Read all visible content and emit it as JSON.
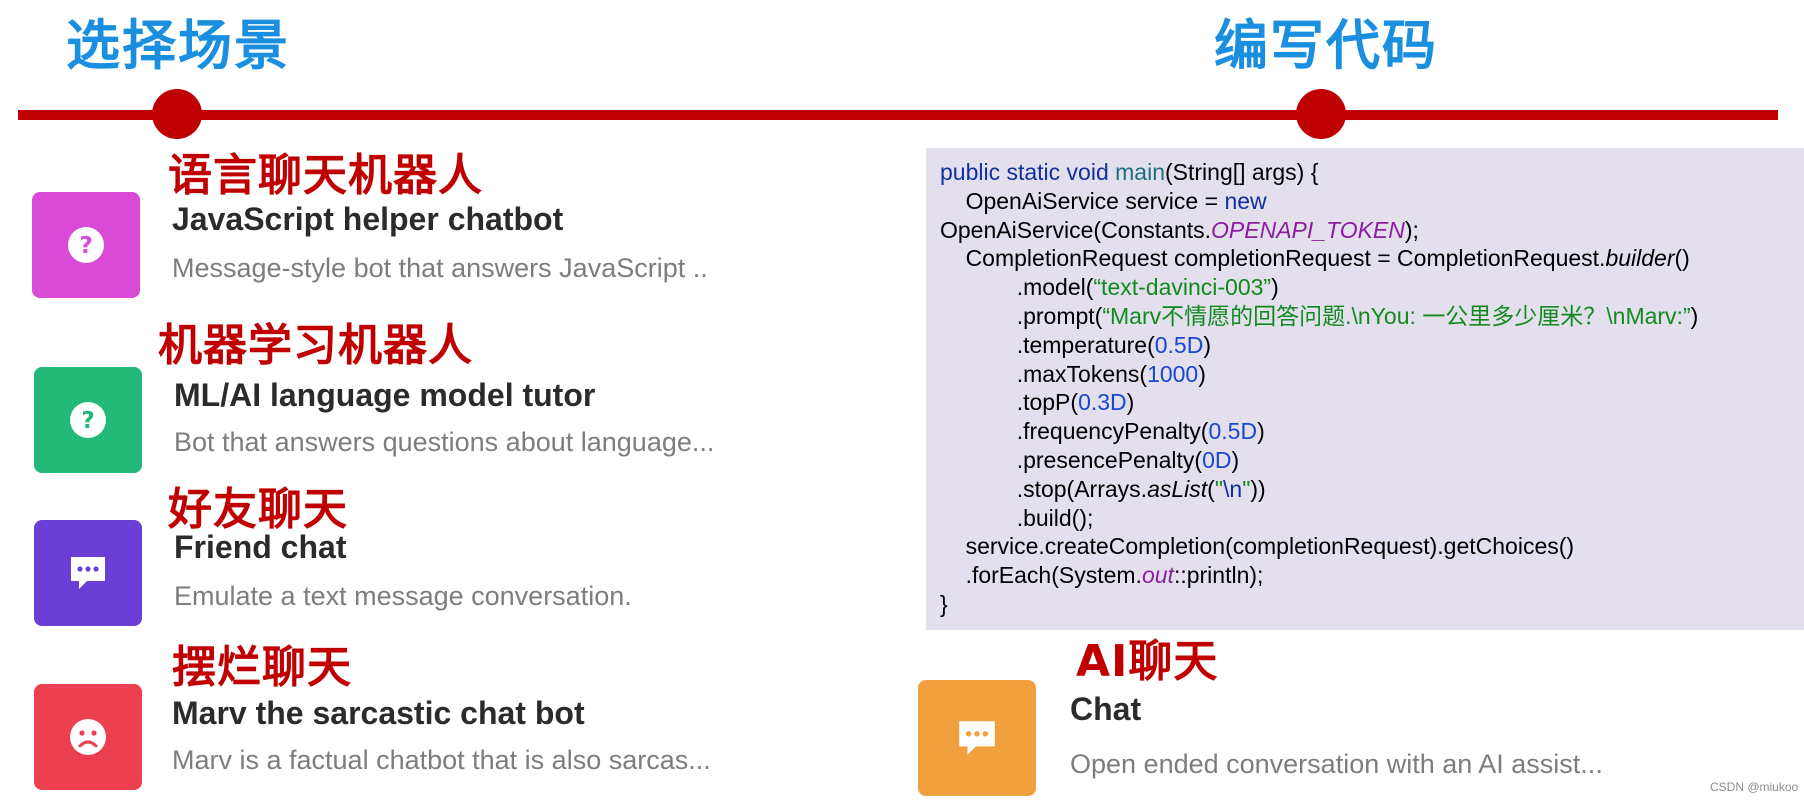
{
  "steps": [
    {
      "title": "选择场景"
    },
    {
      "title": "编写代码"
    }
  ],
  "cards": [
    {
      "tag": "语言聊天机器人",
      "title": "JavaScript helper chatbot",
      "description": "Message-style bot that answers JavaScript ..",
      "icon": "question-circle-icon",
      "color": "#d94ad6"
    },
    {
      "tag": "机器学习机器人",
      "title": "ML/AI language model tutor",
      "description": "Bot that answers questions about language...",
      "icon": "question-circle-icon",
      "color": "#22b878"
    },
    {
      "tag": "好友聊天",
      "title": "Friend chat",
      "description": "Emulate a text message conversation.",
      "icon": "chat-bubble-icon",
      "color": "#6a3fd6"
    },
    {
      "tag": "摆烂聊天",
      "title": "Marv the sarcastic chat bot",
      "description": "Marv is a factual chatbot that is also sarcas...",
      "icon": "sad-face-icon",
      "color": "#ec3f4f"
    },
    {
      "tag": "AI聊天",
      "title": "Chat",
      "description": "Open ended conversation with an AI assist...",
      "icon": "chat-bubble-icon",
      "color": "#f2a03d"
    }
  ],
  "code": {
    "l1_kw": "public static void",
    "l1_fn": "main",
    "l1_rest": "(String[] args) {",
    "l2_a": "OpenAiService service = ",
    "l2_kw": "new",
    "l3_a": "OpenAiService(Constants.",
    "l3_const": "OPENAPI_TOKEN",
    "l3_b": ");",
    "l4_a": "CompletionRequest completionRequest = CompletionRequest.",
    "l4_it": "builder",
    "l4_b": "()",
    "l5_a": ".model(",
    "l5_str": "“text-davinci-003”",
    "l5_b": ")",
    "l6_a": ".prompt(",
    "l6_str": "“Marv不情愿的回答问题.\\nYou: 一公里多少厘米？\\nMarv:”",
    "l6_b": ")",
    "l7_a": ".temperature(",
    "l7_num": "0.5D",
    "l7_b": ")",
    "l8_a": ".maxTokens(",
    "l8_num": "1000",
    "l8_b": ")",
    "l9_a": ".topP(",
    "l9_num": "0.3D",
    "l9_b": ")",
    "l10_a": ".frequencyPenalty(",
    "l10_num": "0.5D",
    "l10_b": ")",
    "l11_a": ".presencePenalty(",
    "l11_num": "0D",
    "l11_b": ")",
    "l12_a": ".stop(Arrays.",
    "l12_it": "asList",
    "l12_b": "(",
    "l12_q1": "\"",
    "l12_esc": "\\n",
    "l12_q2": "\"",
    "l12_c": "))",
    "l13": ".build();",
    "l14": "service.createCompletion(completionRequest).getChoices()",
    "l15_a": ".forEach(System.",
    "l15_const": "out",
    "l15_b": "::println);",
    "l16": "}"
  },
  "watermark": "CSDN @miukoo"
}
